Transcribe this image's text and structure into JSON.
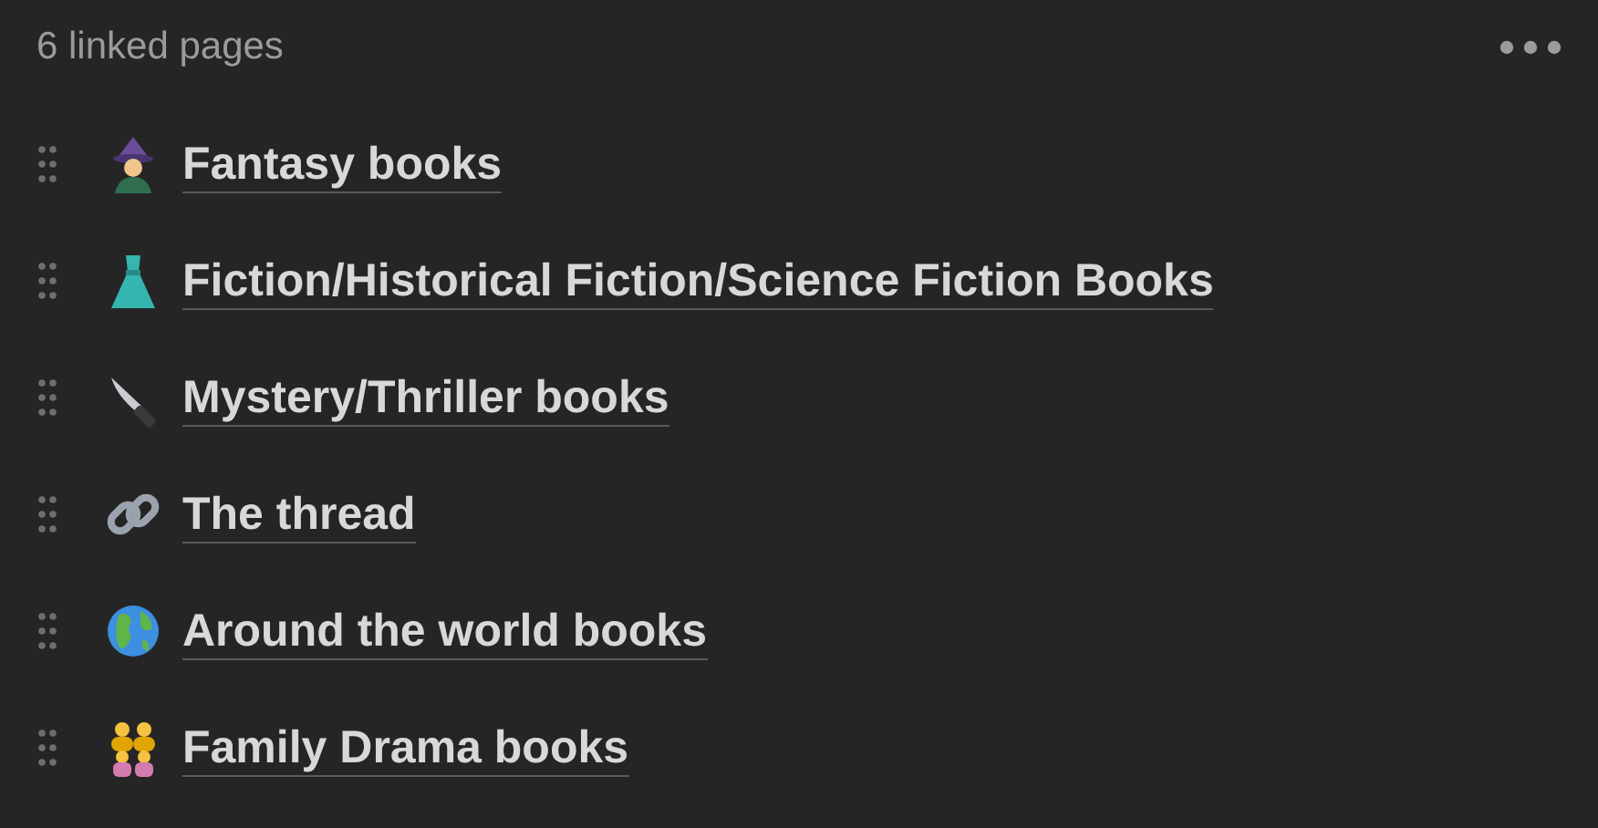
{
  "header": {
    "title": "6 linked pages"
  },
  "pages": [
    {
      "title": "Fantasy books"
    },
    {
      "title": "Fiction/Historical Fiction/Science Fiction Books"
    },
    {
      "title": "Mystery/Thriller books"
    },
    {
      "title": "The thread"
    },
    {
      "title": "Around the world books"
    },
    {
      "title": "Family Drama books"
    }
  ]
}
